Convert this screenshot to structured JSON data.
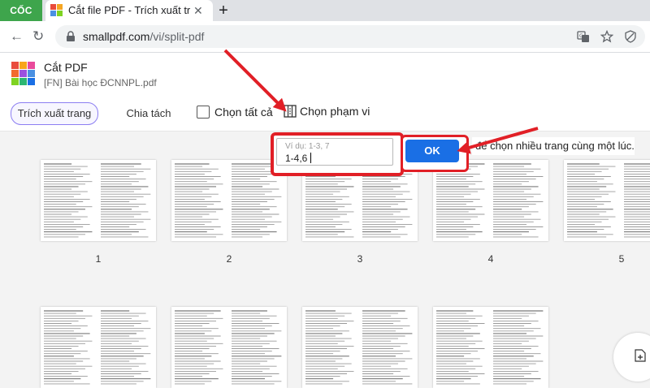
{
  "browser": {
    "brand": "CỐC CỐC",
    "tab_title": "Cắt file PDF - Trích xuất trang",
    "url_domain": "smallpdf.com",
    "url_path": "/vi/split-pdf"
  },
  "app": {
    "title": "Cắt PDF",
    "file_name": "[FN] Bài học ĐCNNPL.pdf"
  },
  "modes": {
    "extract_label": "Trích xuất trang",
    "split_label": "Chia tách",
    "select_all_label": "Chọn tất cả",
    "select_range_label": "Chọn phạm vi"
  },
  "range": {
    "placeholder": "Ví dụ: 1-3, 7",
    "value": "1-4,6",
    "ok_label": "OK",
    "hint": "để chọn nhiều trang cùng một lúc."
  },
  "pages": [
    {
      "number": "1"
    },
    {
      "number": "2"
    },
    {
      "number": "3"
    },
    {
      "number": "4"
    },
    {
      "number": "5"
    }
  ],
  "colors": {
    "accent_blue": "#1a6fe5",
    "highlight_red": "#e11f26",
    "mode_active_border": "#8c7ef2",
    "brand_green": "#3ea54c"
  },
  "icons": {
    "tab": "smallpdf-logo-icon",
    "back": "back-arrow-icon",
    "reload": "reload-icon",
    "lock": "lock-icon",
    "translate": "translate-icon",
    "bookmark": "star-icon",
    "shield": "shield-icon",
    "range": "range-icon",
    "add_pages": "add-file-icon"
  }
}
